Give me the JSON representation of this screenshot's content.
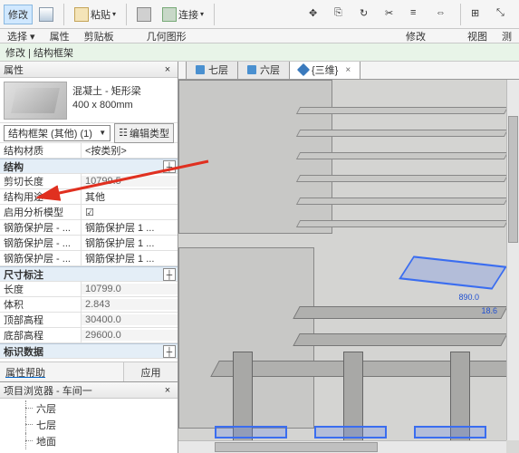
{
  "ribbon": {
    "tab_modify": "修改",
    "paste": "粘贴",
    "connect": "连接",
    "groups": {
      "select": "选择 ▾",
      "props": "属性",
      "clipboard": "剪贴板",
      "geometry": "几何图形",
      "modify": "修改",
      "view": "视图",
      "measure": "测"
    }
  },
  "context_bar": "修改 | 结构框架",
  "props_panel": {
    "title": "属性",
    "type_name": "混凝土 - 矩形梁",
    "type_size": "400 x 800mm",
    "selector": "结构框架 (其他) (1)",
    "edit_type": "编辑类型",
    "rows": [
      {
        "k": "结构材质",
        "v": "<按类别>",
        "group": false,
        "ro": false
      },
      {
        "k": "结构",
        "v": "",
        "group": true
      },
      {
        "k": "剪切长度",
        "v": "10799.5",
        "ro": true
      },
      {
        "k": "结构用途",
        "v": "其他",
        "ro": false
      },
      {
        "k": "启用分析模型",
        "v": "☑",
        "ro": false
      },
      {
        "k": "钢筋保护层 - ...",
        "v": "钢筋保护层 1 ..."
      },
      {
        "k": "钢筋保护层 - ...",
        "v": "钢筋保护层 1 ..."
      },
      {
        "k": "钢筋保护层 - ...",
        "v": "钢筋保护层 1 ..."
      },
      {
        "k": "尺寸标注",
        "v": "",
        "group": true
      },
      {
        "k": "长度",
        "v": "10799.0",
        "ro": true
      },
      {
        "k": "体积",
        "v": "2.843",
        "ro": true
      },
      {
        "k": "顶部高程",
        "v": "30400.0",
        "ro": true
      },
      {
        "k": "底部高程",
        "v": "29600.0",
        "ro": true
      },
      {
        "k": "标识数据",
        "v": "",
        "group": true
      }
    ],
    "help": "属性帮助",
    "apply": "应用"
  },
  "browser": {
    "title": "项目浏览器 - 车间一",
    "items": [
      "六层",
      "七层",
      "地面"
    ]
  },
  "view_tabs": [
    {
      "label": "七层",
      "active": false
    },
    {
      "label": "六层",
      "active": false
    },
    {
      "label": "{三维}",
      "active": true,
      "d3": true
    }
  ],
  "annotation_values": [
    "890.0",
    "18.6"
  ]
}
